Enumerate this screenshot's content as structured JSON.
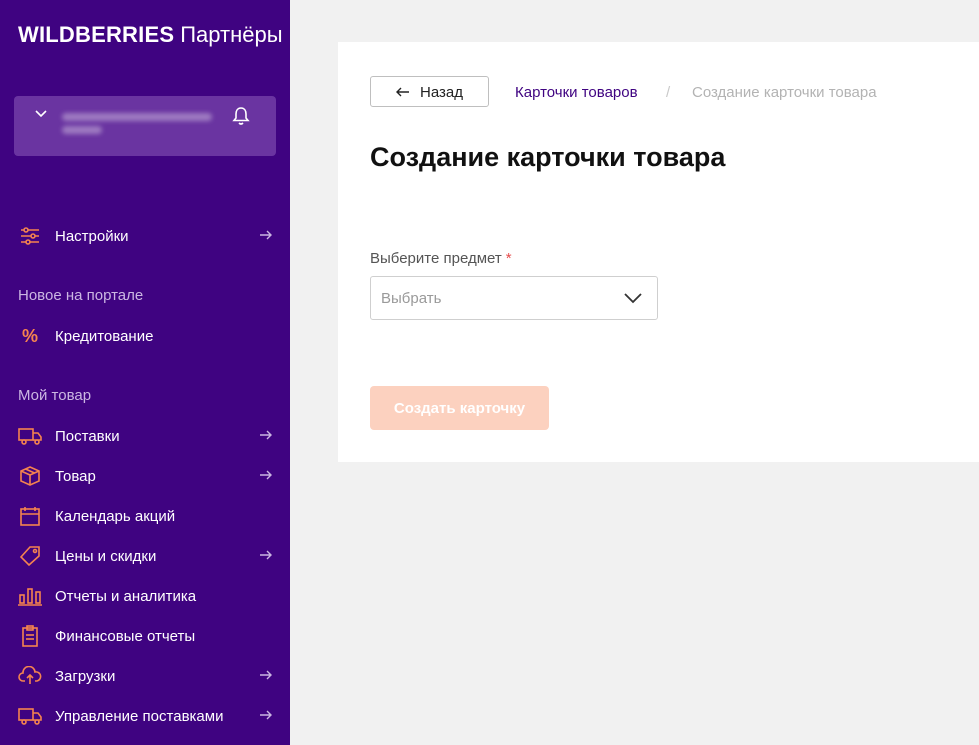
{
  "sidebar": {
    "logo_brand": "WILDBERRIES",
    "logo_sub": "Партнёры",
    "settings_label": "Настройки",
    "section_new": "Новое на портале",
    "credit_label": "Кредитование",
    "section_my_goods": "Мой товар",
    "items": [
      {
        "label": "Поставки",
        "icon": "truck-icon",
        "arrow": true
      },
      {
        "label": "Товар",
        "icon": "box-icon",
        "arrow": true
      },
      {
        "label": "Календарь акций",
        "icon": "calendar-icon",
        "arrow": false
      },
      {
        "label": "Цены и скидки",
        "icon": "tag-icon",
        "arrow": true
      },
      {
        "label": "Отчеты и аналитика",
        "icon": "bar-chart-icon",
        "arrow": false
      },
      {
        "label": "Финансовые отчеты",
        "icon": "clipboard-icon",
        "arrow": false
      },
      {
        "label": "Загрузки",
        "icon": "cloud-upload-icon",
        "arrow": true
      },
      {
        "label": "Управление поставками",
        "icon": "truck-icon",
        "arrow": true
      }
    ]
  },
  "breadcrumb": {
    "back_label": "Назад",
    "link_label": "Карточки товаров",
    "separator": "/",
    "current_label": "Создание карточки товара"
  },
  "main": {
    "title": "Создание карточки товара",
    "field_label": "Выберите предмет",
    "required_mark": "*",
    "select_placeholder": "Выбрать",
    "create_button_label": "Создать карточку"
  },
  "colors": {
    "sidebar_bg": "#3f0381",
    "accent_orange": "#f5834f",
    "button_disabled": "#fcd1bf",
    "link_purple": "#3f0381"
  }
}
